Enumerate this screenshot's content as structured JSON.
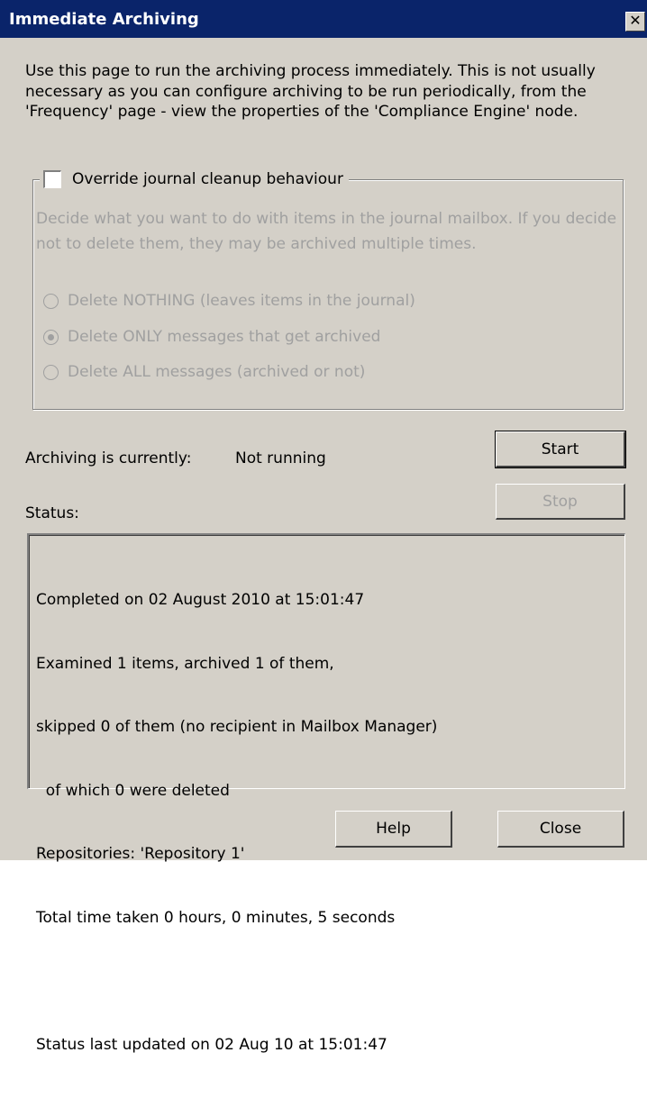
{
  "window": {
    "title": "Immediate Archiving",
    "close_glyph": "✕"
  },
  "intro_text": "Use this page to run the archiving process immediately. This is not usually necessary as you can configure archiving to be run periodically, from the 'Frequency' page - view the properties of the 'Compliance Engine' node.",
  "journal_group": {
    "checkbox_label": "Override journal cleanup behaviour",
    "checkbox_checked": false,
    "description": "Decide what you want to do with items in the journal mailbox. If you decide not to delete them, they may be archived multiple times.",
    "options": [
      {
        "label": "Delete NOTHING (leaves items in the journal)",
        "selected": false
      },
      {
        "label": "Delete ONLY messages that get archived",
        "selected": true
      },
      {
        "label": "Delete ALL messages (archived or not)",
        "selected": false
      }
    ],
    "enabled": false
  },
  "archiving_state": {
    "label": "Archiving is currently:",
    "value": "Not running"
  },
  "status": {
    "label": "Status:",
    "lines": [
      "Completed on 02 August 2010 at 15:01:47",
      "Examined 1 items, archived 1 of them,",
      "skipped 0 of them (no recipient in Mailbox Manager)",
      "  of which 0 were deleted",
      "Repositories: 'Repository 1'",
      "Total time taken 0 hours, 0 minutes, 5 seconds",
      "",
      "Status last updated on 02 Aug 10 at 15:01:47"
    ]
  },
  "buttons": {
    "start": "Start",
    "stop": "Stop",
    "help": "Help",
    "close": "Close"
  },
  "colors": {
    "titlebar": "#0a246a",
    "dialog_face": "#d4d0c8",
    "disabled_text": "#a0a0a0"
  }
}
